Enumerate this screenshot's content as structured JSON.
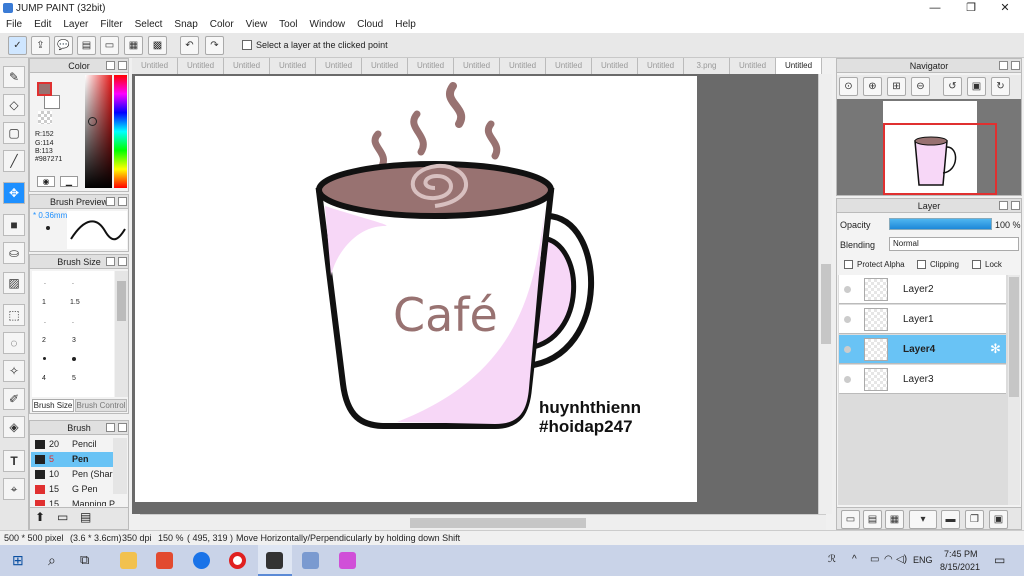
{
  "window": {
    "title": "JUMP PAINT (32bit)",
    "minimize": "—",
    "maximize": "❐",
    "close": "✕"
  },
  "menu": [
    "File",
    "Edit",
    "Layer",
    "Filter",
    "Select",
    "Snap",
    "Color",
    "View",
    "Tool",
    "Window",
    "Cloud",
    "Help"
  ],
  "toolbar": {
    "checkbox_label": "Select a layer at the clicked point"
  },
  "color_panel": {
    "title": "Color",
    "r": "R:152",
    "g": "G:114",
    "b": "B:113",
    "hex": "#987271",
    "main_color": "#987271"
  },
  "brush_preview": {
    "title": "Brush Preview",
    "size": "* 0.36mm"
  },
  "brush_size": {
    "title": "Brush Size",
    "labels": [
      ".",
      ".",
      "1",
      "1.5",
      ".",
      ".",
      "2",
      "3",
      "4",
      "5"
    ],
    "tab_active": "Brush Size",
    "tab_inactive": "Brush Control"
  },
  "brush": {
    "title": "Brush",
    "items": [
      {
        "size": "20",
        "name": "Pencil",
        "color": "#222222"
      },
      {
        "size": "5",
        "name": "Pen",
        "color": "#222222"
      },
      {
        "size": "10",
        "name": "Pen (Shar",
        "color": "#222222"
      },
      {
        "size": "15",
        "name": "G Pen",
        "color": "#e03030"
      },
      {
        "size": "15",
        "name": "Mapping P",
        "color": "#e03030"
      }
    ]
  },
  "tabs": [
    "Untitled",
    "Untitled",
    "Untitled",
    "Untitled",
    "Untitled",
    "Untitled",
    "Untitled",
    "Untitled",
    "Untitled",
    "Untitled",
    "Untitled",
    "Untitled",
    "3.png",
    "Untitled",
    "Untitled"
  ],
  "artwork": {
    "cup_text": "Café",
    "credit_1": "huynhthienn",
    "credit_2": "#hoidap247"
  },
  "navigator": {
    "title": "Navigator"
  },
  "layer_panel": {
    "title": "Layer",
    "opacity_label": "Opacity",
    "opacity_value": "100 %",
    "opacity": 1.0,
    "blending_label": "Blending",
    "blending_value": "Normal",
    "protect_alpha": "Protect Alpha",
    "clipping": "Clipping",
    "lock": "Lock",
    "layers": [
      {
        "name": "Layer2"
      },
      {
        "name": "Layer1"
      },
      {
        "name": "Layer4"
      },
      {
        "name": "Layer3"
      }
    ]
  },
  "status": {
    "size": "500 * 500 pixel",
    "cm": "(3.6 * 3.6cm)",
    "dpi": "350 dpi",
    "zoom": "150 %",
    "coords": "( 495, 319 )",
    "hint": "Move Horizontally/Perpendicularly by holding down Shift"
  },
  "taskbar": {
    "lang": "ENG",
    "time": "7:45 PM",
    "date": "8/15/2021"
  },
  "colors": {
    "accent": "#1e90ff",
    "selected_row": "#69c3f5",
    "cup_outline": "#111111",
    "cup_pink": "#f7d7f7",
    "coffee": "#987271"
  }
}
